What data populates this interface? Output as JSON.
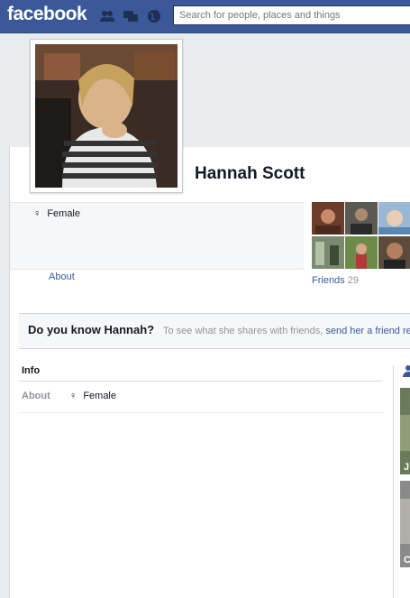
{
  "header": {
    "logo": "facebook",
    "search_placeholder": "Search for people, places and things"
  },
  "profile": {
    "name": "Hannah Scott",
    "gender": "Female",
    "about_link": "About"
  },
  "friends": {
    "label": "Friends",
    "count": "29"
  },
  "know_bar": {
    "title": "Do you know Hannah?",
    "text": "To see what she shares with friends, ",
    "link": "send her a friend re"
  },
  "info": {
    "header": "Info",
    "about_label": "About",
    "gender": "Female"
  },
  "side_photos": [
    {
      "label": "J"
    },
    {
      "label": "C"
    }
  ],
  "colors": {
    "brand": "#3b5998",
    "link": "#3b5998",
    "muted": "#90949c"
  }
}
